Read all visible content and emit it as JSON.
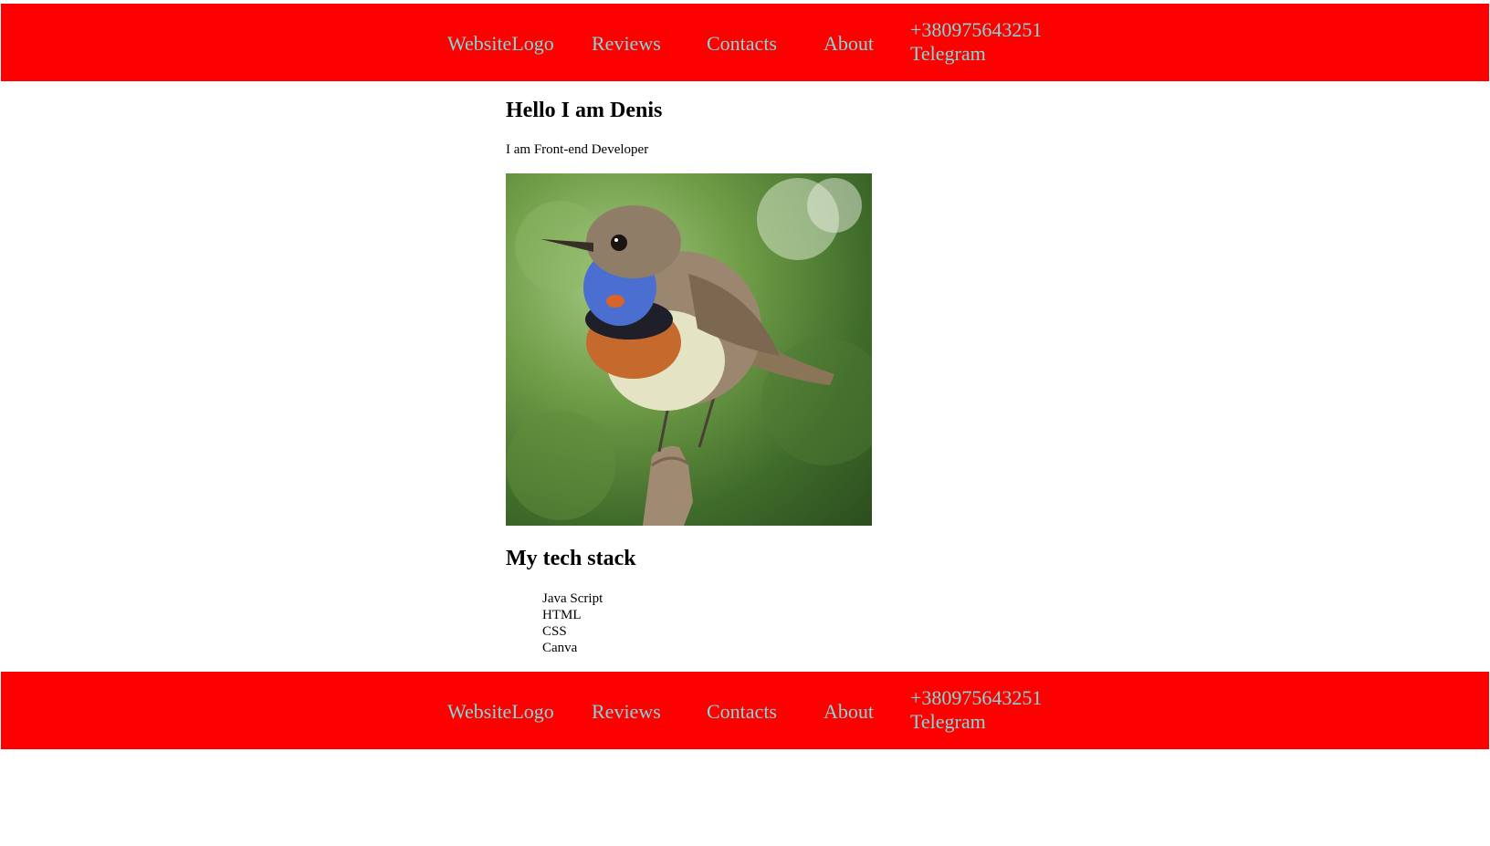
{
  "nav": {
    "logo": "WebsiteLogo",
    "reviews": "Reviews",
    "contacts": "Contacts",
    "about": "About",
    "phone": "+380975643251",
    "telegram": "Telegram"
  },
  "hero": {
    "title": "Hello I am Denis",
    "subtitle": "I am Front-end Developer",
    "image_alt": "bluethroat bird on a branch"
  },
  "tech": {
    "title": "My tech stack",
    "items": [
      "Java Script",
      "HTML",
      "CSS",
      "Canva"
    ]
  },
  "colors": {
    "bar": "#ff0000",
    "link": "#7fd8d8",
    "text": "#000000"
  }
}
